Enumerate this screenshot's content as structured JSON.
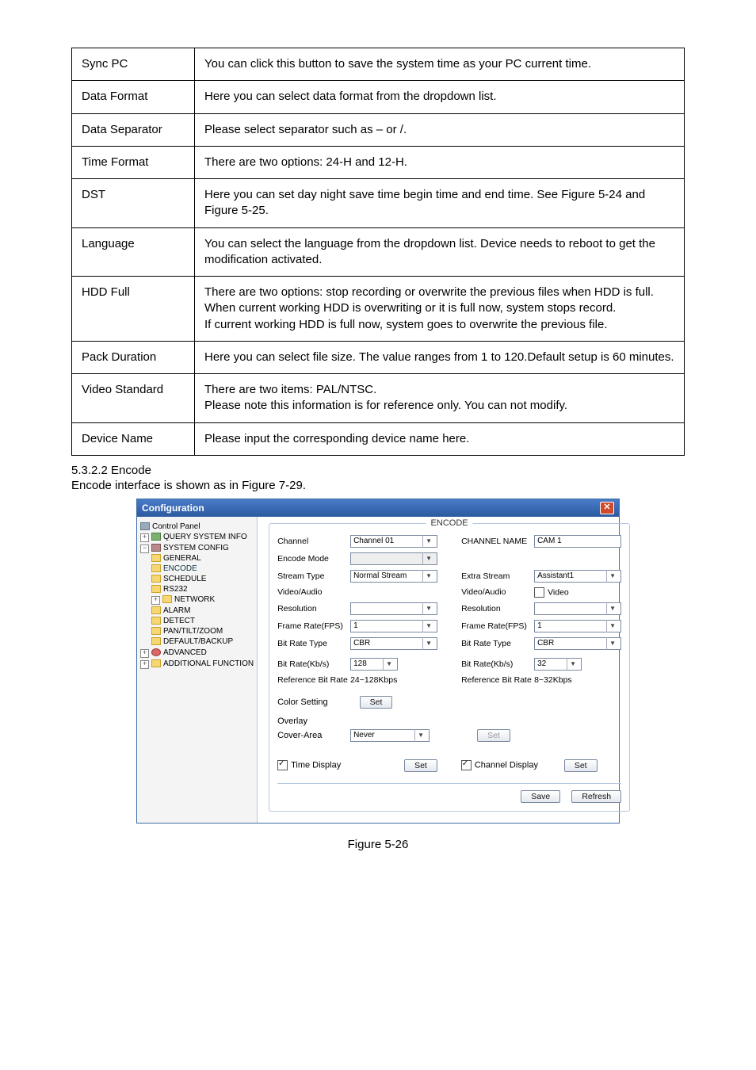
{
  "table": {
    "rows": [
      {
        "param": "Sync PC",
        "desc": "You can click this button to save the system time as your PC current time."
      },
      {
        "param": "Data Format",
        "desc": "Here you can select data format from the dropdown list."
      },
      {
        "param": "Data Separator",
        "desc": "Please select separator such as – or /."
      },
      {
        "param": "Time Format",
        "desc": "There are two options: 24-H and 12-H."
      },
      {
        "param": "DST",
        "desc": "Here you can set day night save time begin time and end time. See Figure 5-24 and Figure 5-25."
      },
      {
        "param": "Language",
        "desc": "You can select the language from the dropdown list. Device needs to reboot to get the modification activated."
      },
      {
        "param": "HDD Full",
        "desc": "There are two options: stop recording or overwrite the previous files when HDD is full.\nWhen current working HDD is overwriting or it is full now, system stops record.\nIf current working HDD is full now, system goes to overwrite the previous file."
      },
      {
        "param": "Pack Duration",
        "desc": "Here you can select file size. The value ranges from 1 to 120.Default setup is 60 minutes."
      },
      {
        "param": "Video Standard",
        "desc": "There are two items: PAL/NTSC.\nPlease note this information is for reference only. You can not modify."
      },
      {
        "param": "Device Name",
        "desc": "Please input the corresponding device name here."
      }
    ]
  },
  "section": {
    "heading": "5.3.2.2  Encode",
    "intro": "Encode interface is shown as in Figure 7-29."
  },
  "config": {
    "title": "Configuration",
    "tree": {
      "control_panel": "Control Panel",
      "query_system_info": "QUERY SYSTEM INFO",
      "system_config": "SYSTEM CONFIG",
      "general": "GENERAL",
      "encode": "ENCODE",
      "schedule": "SCHEDULE",
      "rs232": "RS232",
      "network": "NETWORK",
      "alarm": "ALARM",
      "detect": "DETECT",
      "pan_tilt_zoom": "PAN/TILT/ZOOM",
      "default_backup": "DEFAULT/BACKUP",
      "advanced": "ADVANCED",
      "additional_function": "ADDITIONAL FUNCTION"
    },
    "legend": "ENCODE",
    "labels": {
      "channel": "Channel",
      "channel_name": "CHANNEL NAME",
      "encode_mode": "Encode Mode",
      "stream_type": "Stream Type",
      "extra_stream": "Extra Stream",
      "video_audio": "Video/Audio",
      "video": "Video",
      "resolution": "Resolution",
      "frame_rate": "Frame Rate(FPS)",
      "bit_rate_type": "Bit Rate Type",
      "bit_rate": "Bit Rate(Kb/s)",
      "ref_bit_rate": "Reference Bit Rate",
      "color_setting": "Color Setting",
      "overlay": "Overlay",
      "cover_area": "Cover-Area",
      "time_display": "Time Display",
      "channel_display": "Channel Display"
    },
    "values": {
      "channel": "Channel 01",
      "channel_name": "CAM 1",
      "stream_type": "Normal Stream",
      "extra_stream": "Assistant1",
      "frame_rate_left": "1",
      "frame_rate_right": "1",
      "bit_rate_type_left": "CBR",
      "bit_rate_type_right": "CBR",
      "bit_rate_left": "128",
      "bit_rate_right": "32",
      "ref_bit_rate_left": "24~128Kbps",
      "ref_bit_rate_right": "8~32Kbps",
      "cover_area": "Never"
    },
    "buttons": {
      "set": "Set",
      "save": "Save",
      "refresh": "Refresh"
    }
  },
  "figure_caption": "Figure 5-26"
}
